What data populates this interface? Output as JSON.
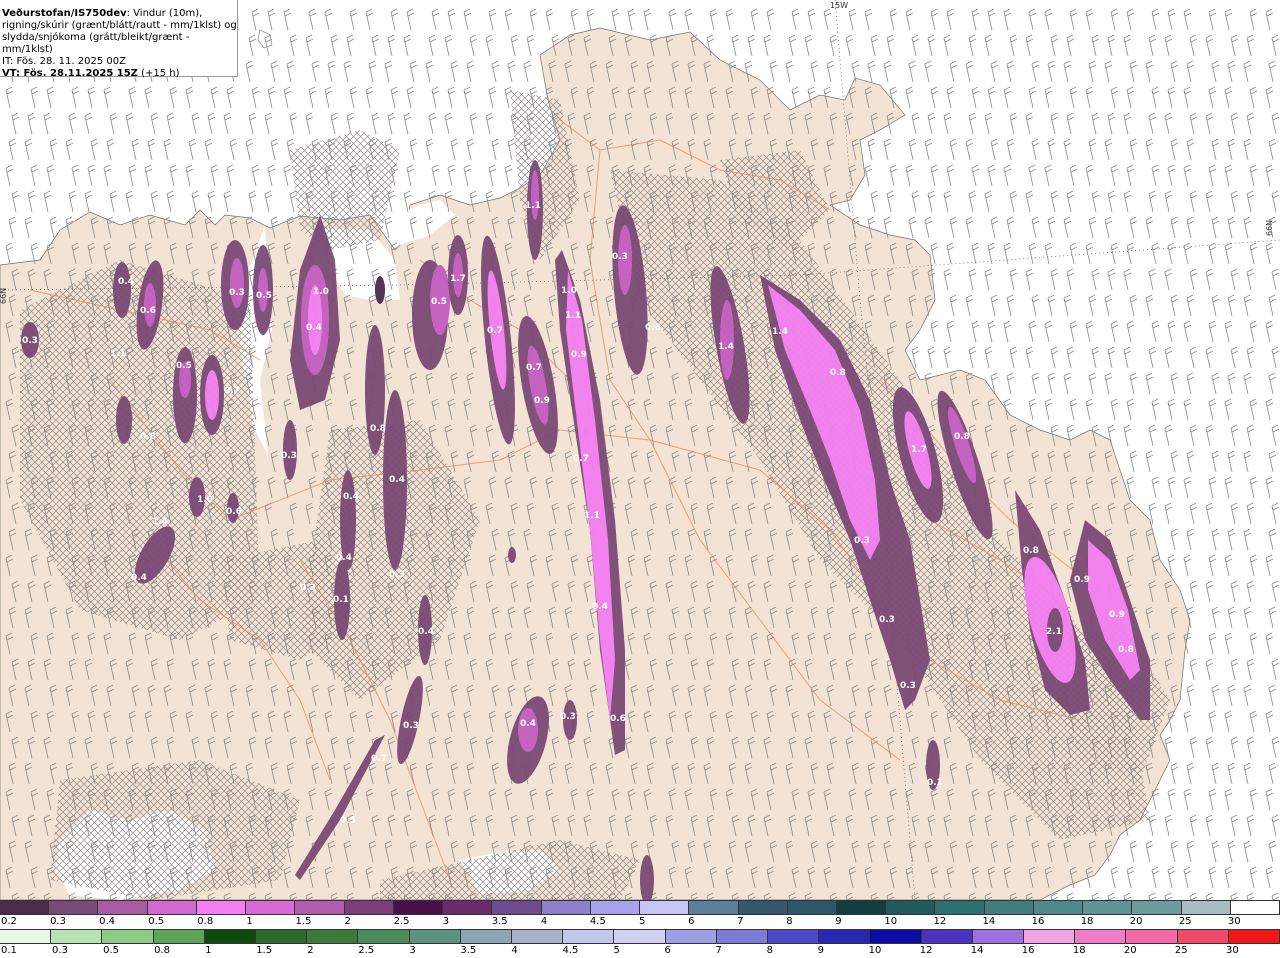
{
  "title": {
    "line1_bold": "Veðurstofan/IS750dev",
    "line1_rest": ": Vindur (10m),",
    "line2": "rigning/skúrir (grænt/blátt/rautt - mm/1klst) og",
    "line3": "slydda/snjókoma (grátt/bleikt/grænt - mm/1klst)",
    "it": "IT: Fös. 28. 11. 2025 00Z",
    "vt_bold": "VT: Fös. 28.11.2025 15Z",
    "vt_rest": " (+15 h)"
  },
  "grid_labels": {
    "top": "15W",
    "right": "66N",
    "left": "66N"
  },
  "colors": {
    "sea": "#ffffff",
    "land": "#f3e3d4",
    "roads": "#e8916a",
    "barbs": "#8a8a8a",
    "precip_light": "#7a4a75",
    "precip_mid": "#c25cc0",
    "precip_heavy": "#f27ef0"
  },
  "precip_values": [
    "0.3",
    "0.4",
    "0.6",
    "0.5",
    "1.1",
    "0.7",
    "0.8",
    "1.0",
    "0.6",
    "1.4",
    "0.4",
    "0.3",
    "0.5",
    "0.3",
    "0.4",
    "1.0",
    "0.8",
    "0.4",
    "0.4",
    "0.4",
    "0.3",
    "0.1",
    "0.3",
    "0.4",
    "0.3",
    "0.7",
    "0.5",
    "0.5",
    "1.7",
    "0.7",
    "0.7",
    "0.9",
    "1.1",
    "1.0",
    "1.1",
    "0.9",
    "0.7",
    "1.1",
    "0.4",
    "0.6",
    "0.3",
    "0.4",
    "0.3",
    "0.6",
    "1.4",
    "1.4",
    "0.8",
    "0.3",
    "0.3",
    "0.1",
    "1.7",
    "0.8",
    "0.8",
    "0.9",
    "0.9",
    "2.1",
    "0.8",
    "0.3"
  ],
  "legend_snow": {
    "ticks": [
      "0.2",
      "0.3",
      "0.4",
      "0.5",
      "0.8",
      "1",
      "1.5",
      "2",
      "2.5",
      "3",
      "3.5",
      "4",
      "4.5",
      "5",
      "6",
      "7",
      "8",
      "9",
      "10",
      "12",
      "14",
      "16",
      "18",
      "20",
      "25",
      "30"
    ],
    "colors": [
      "#4b2a4e",
      "#7a4a78",
      "#a65ba3",
      "#cf6bcc",
      "#f57ef2",
      "#d86ad6",
      "#b15cae",
      "#7c3d7a",
      "#4a0f4a",
      "#6b2a6a",
      "#6e4a8e",
      "#8f7fc9",
      "#a7a2ea",
      "#c7c5f7",
      "#5c7f9e",
      "#35586c",
      "#2d5668",
      "#133e40",
      "#1f5a5c",
      "#2e6f72",
      "#3f7d7f",
      "#4e8a8c",
      "#5f9494",
      "#6d9a9b",
      "#a9bcc2",
      "#ffffff"
    ]
  },
  "legend_rain": {
    "ticks": [
      "0.1",
      "0.3",
      "0.5",
      "0.8",
      "1",
      "1.5",
      "2",
      "2.5",
      "3",
      "3.5",
      "4",
      "4.5",
      "5",
      "6",
      "7",
      "8",
      "9",
      "10",
      "12",
      "14",
      "16",
      "18",
      "20",
      "25",
      "30"
    ],
    "colors": [
      "#e6f9e6",
      "#b7e3b2",
      "#8bcb86",
      "#5ea35a",
      "#0d4a0d",
      "#2a6a2a",
      "#3a7a3a",
      "#4b8a5a",
      "#5d9280",
      "#8aa6b2",
      "#a6b2cc",
      "#c2c8ea",
      "#cfd1f5",
      "#9e9ee4",
      "#7c7cd8",
      "#4a4ac8",
      "#2727b4",
      "#0b0ba3",
      "#4d31c0",
      "#a06fe0",
      "#f3a6e6",
      "#f07cc8",
      "#f06aa8",
      "#f04a6a",
      "#f01818"
    ]
  }
}
